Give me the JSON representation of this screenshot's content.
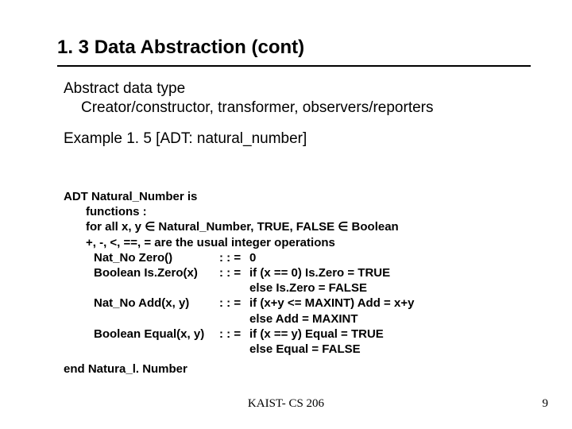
{
  "title": "1. 3 Data Abstraction (cont)",
  "body": {
    "line1": "Abstract data type",
    "line2": "Creator/constructor, transformer, observers/reporters",
    "example": "Example 1. 5 [ADT: natural_number]"
  },
  "adt": {
    "header": "ADT Natural_Number is",
    "functions": "functions :",
    "forall": "for all x, y ∈ Natural_Number, TRUE, FALSE ∈ Boolean",
    "ops": "+, -, <, ==, = are the usual integer operations",
    "rows": [
      {
        "left": "Nat_No Zero()",
        "mid": ": : =",
        "right": "0"
      },
      {
        "left": "Boolean Is.Zero(x)",
        "mid": ": : =",
        "right": "if (x == 0) Is.Zero = TRUE"
      },
      {
        "left": "",
        "mid": "",
        "right": "else Is.Zero = FALSE"
      },
      {
        "left": "Nat_No Add(x, y)",
        "mid": ": : =",
        "right": "if (x+y <= MAXINT) Add = x+y"
      },
      {
        "left": "",
        "mid": "",
        "right": "else Add = MAXINT"
      },
      {
        "left": "Boolean Equal(x, y)",
        "mid": ": : =",
        "right": "if (x == y) Equal = TRUE"
      },
      {
        "left": "",
        "mid": "",
        "right": "else Equal = FALSE"
      }
    ],
    "end": "end Natura_l. Number"
  },
  "footer": {
    "center": "KAIST- CS 206",
    "page": "9"
  }
}
